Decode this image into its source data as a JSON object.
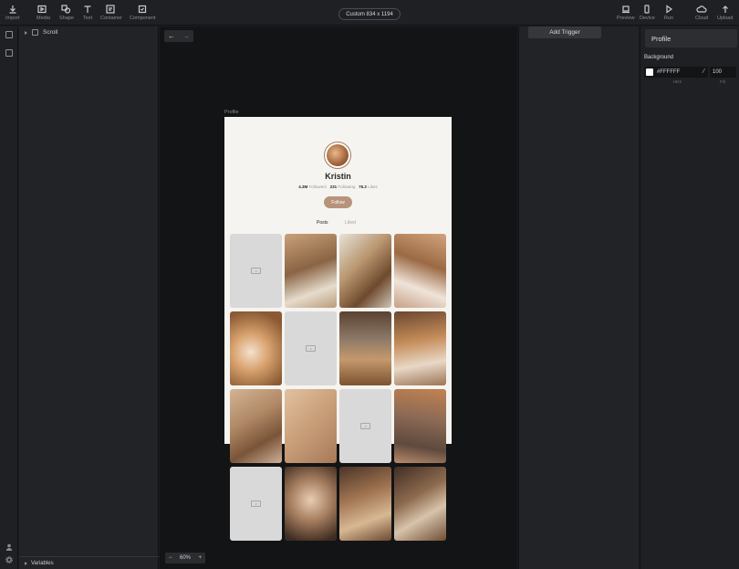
{
  "toolbar": {
    "import": "Import",
    "media": "Media",
    "shape": "Shape",
    "text": "Text",
    "container": "Container",
    "component": "Component",
    "canvas_size": "Custom  834 x 1194",
    "preview": "Preview",
    "device": "Device",
    "run": "Run",
    "cloud": "Cloud",
    "upload": "Upload"
  },
  "layers": {
    "items": [
      {
        "label": "Scroll"
      }
    ],
    "variables": "Variables"
  },
  "canvas": {
    "frame_label": "Profile",
    "zoom": "60%",
    "zoom_minus": "−",
    "zoom_plus": "+",
    "profile": {
      "name": "Kristin",
      "followers_count": "4.3M",
      "followers_label": "Followers",
      "following_count": "231",
      "following_label": "Following",
      "likes_count": "76.2",
      "likes_label": "Likes",
      "follow_button": "Follow",
      "tab_posts": "Posts",
      "tab_liked": "Liked"
    }
  },
  "triggers": {
    "add_trigger": "Add Trigger"
  },
  "properties": {
    "title": "Profile",
    "background_label": "Background",
    "hex_value": "#FFFFFF",
    "fill_value": "100",
    "hex_caption": "HEX",
    "fill_caption": "Fill"
  },
  "colors": {
    "accent": "#b8937b",
    "canvas_bg": "#131416",
    "panel_bg": "#222327"
  }
}
